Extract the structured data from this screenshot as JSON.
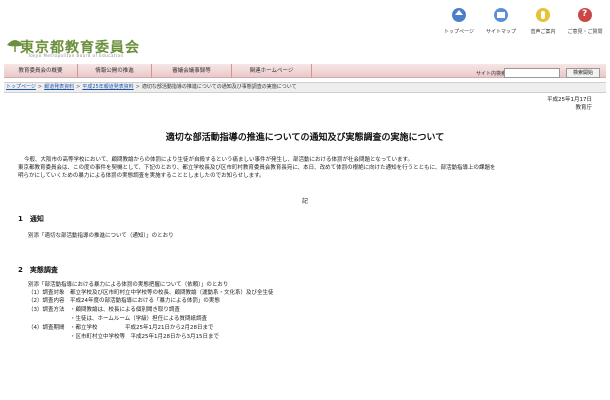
{
  "header": {
    "org_name": "東京都教育委員会",
    "org_name_en": "Tokyo Metropolitan Board of Education",
    "utility_links": [
      {
        "label": "トップページ",
        "icon": "home-icon"
      },
      {
        "label": "サイトマップ",
        "icon": "sitemap-icon"
      },
      {
        "label": "音声ご案内",
        "icon": "ear-icon"
      },
      {
        "label": "ご意見・ご質問",
        "icon": "question-icon"
      }
    ]
  },
  "nav": {
    "items": [
      "教育委員会の概要",
      "情報公開の推進",
      "審議会議事録等",
      "関連ホームページ"
    ],
    "search_label": "サイト内検索",
    "search_value": "",
    "search_button": "検索開始"
  },
  "breadcrumb": {
    "items": [
      "トップページ",
      "報道発表資料",
      "平成25年報道発表資料"
    ],
    "current": "適切な部活動指導の推進についての通知及び事態調査の実施について"
  },
  "date": {
    "line1": "平成25年1月17日",
    "line2": "教育庁"
  },
  "title": "適切な部活動指導の推進についての通知及び実態調査の実施について",
  "intro": {
    "line1": "今般、大阪市の高等学校において、顧問教諭からの体罰により生徒が自殺するという痛ましい事件が発生し、部活動における体罰が社会問題となっています。",
    "line2": "東京都教育委員会は、この度の事件を契機として、下記のとおり、都立学校長及び区市町村教育委員会教育長宛に、本日、改めて体罰の根絶に向けた通知を行うとともに、部活動指導上の課題を",
    "line3": "明らかにしていくための暴力による体罰の実態調査を実施することとしましたのでお知らせします。"
  },
  "ki": "記",
  "section1": {
    "heading": "1　通知",
    "body": "別添「適切な部活動指導の推進について（通知）」のとおり"
  },
  "section2": {
    "heading": "2　実態調査",
    "lines": [
      "別添「部活動指導における暴力による体罰の実態把握について（依頼）」のとおり",
      "（1）調査対象　都立学校及び区市町村立中学校等の校長、顧問教諭（運動系・文化系）及び全生徒",
      "（2）調査内容　平成24年度の部活動指導における「暴力による体罰」の実態",
      "（3）調査方法　・顧問教諭は、校長による個別聞き取り調査",
      "・生徒は、ホームルーム（学級）担任による質問紙調査",
      "（4）調査期間　・都立学校　　　　　平成25年1月21日から2月28日まで",
      "・区市町村立中学校等　平成25年1月28日から3月15日まで"
    ]
  },
  "colors": {
    "logo_green": "#6b8f3a",
    "nav_pink": "#eac9c9",
    "link_blue": "#2255aa"
  }
}
